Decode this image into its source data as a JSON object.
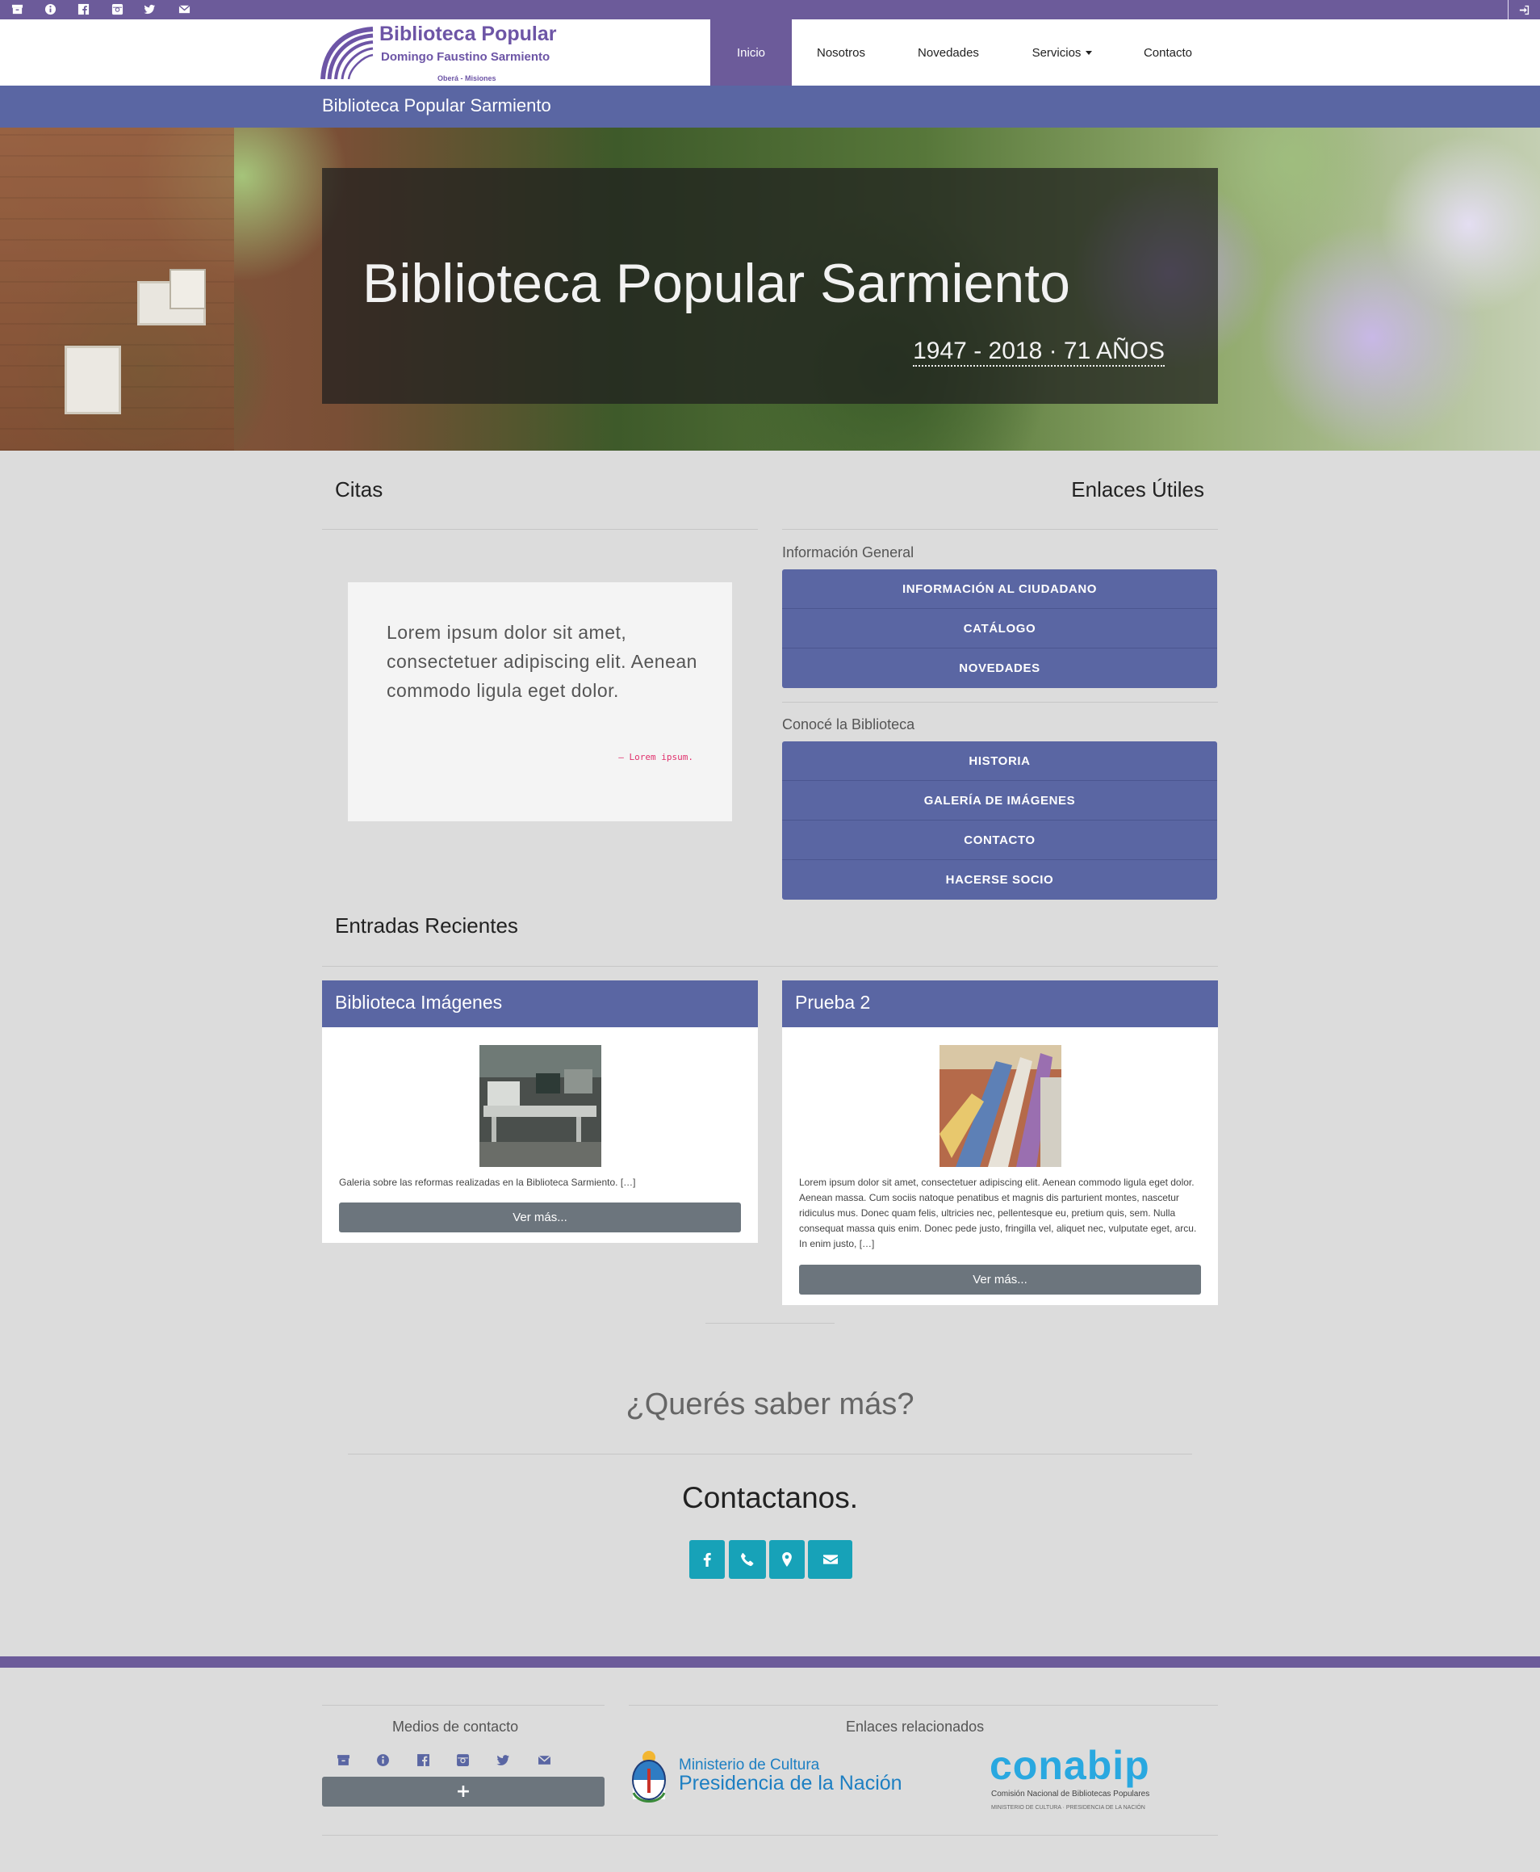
{
  "topbar": {
    "icons": [
      "archive-icon",
      "info-icon",
      "facebook-icon",
      "instagram-icon",
      "twitter-icon",
      "mail-icon"
    ],
    "login_icon": "login-icon"
  },
  "logo": {
    "line1": "Biblioteca Popular",
    "line2": "Domingo Faustino Sarmiento",
    "line3": "Oberá - Misiones"
  },
  "nav": {
    "items": [
      {
        "label": "Inicio",
        "active": true
      },
      {
        "label": "Nosotros"
      },
      {
        "label": "Novedades"
      },
      {
        "label": "Servicios",
        "dropdown": true
      },
      {
        "label": "Contacto"
      }
    ]
  },
  "subheader": {
    "title": "Biblioteca Popular Sarmiento"
  },
  "hero": {
    "title": "Biblioteca Popular Sarmiento",
    "subtitle": "1947 - 2018 · 71 AÑOS"
  },
  "citas": {
    "title": "Citas",
    "quote": "Lorem ipsum dolor sit amet, consectetuer adipiscing elit. Aenean commodo ligula eget dolor.",
    "cite": "— Lorem ipsum."
  },
  "enlaces": {
    "title": "Enlaces Útiles",
    "groups": [
      {
        "label": "Información General",
        "links": [
          "INFORMACIÓN AL CIUDADANO",
          "CATÁLOGO",
          "NOVEDADES"
        ]
      },
      {
        "label": "Conocé la Biblioteca",
        "links": [
          "HISTORIA",
          "GALERÍA DE IMÁGENES",
          "CONTACTO",
          "HACERSE SOCIO"
        ]
      }
    ]
  },
  "entradas": {
    "title": "Entradas Recientes",
    "posts": [
      {
        "title": "Biblioteca Imágenes",
        "text": "Galeria sobre las reformas realizadas en la Biblioteca Sarmiento. […]",
        "button": "Ver más..."
      },
      {
        "title": "Prueba 2",
        "text": "Lorem ipsum dolor sit amet, consectetuer adipiscing elit. Aenean commodo ligula eget dolor. Aenean massa. Cum sociis natoque penatibus et magnis dis parturient montes, nascetur ridiculus mus. Donec quam felis, ultricies nec, pellentesque eu, pretium quis, sem. Nulla consequat massa quis enim. Donec pede justo, fringilla vel, aliquet nec, vulputate eget, arcu. In enim justo, […]",
        "button": "Ver más..."
      }
    ]
  },
  "cta": {
    "question": "¿Querés saber más?",
    "contact": "Contactanos.",
    "buttons": [
      "facebook-icon",
      "phone-icon",
      "map-marker-icon",
      "envelope-icon"
    ]
  },
  "footer": {
    "medios_label": "Medios de contacto",
    "enlaces_label": "Enlaces relacionados",
    "plus_label": "+",
    "mincult_line1": "Ministerio de Cultura",
    "mincult_line2": "Presidencia de la Nación",
    "conabip_big": "conabip",
    "conabip_sub1": "Comisión Nacional de Bibliotecas Populares",
    "conabip_sub2": "MINISTERIO DE CULTURA · PRESIDENCIA DE LA NACIÓN"
  },
  "colors": {
    "purple": "#6c5b9a",
    "indigo": "#5a66a3",
    "teal": "#17a2b8",
    "grey_button": "#6c757d",
    "page_bg": "#dcdcdc"
  }
}
